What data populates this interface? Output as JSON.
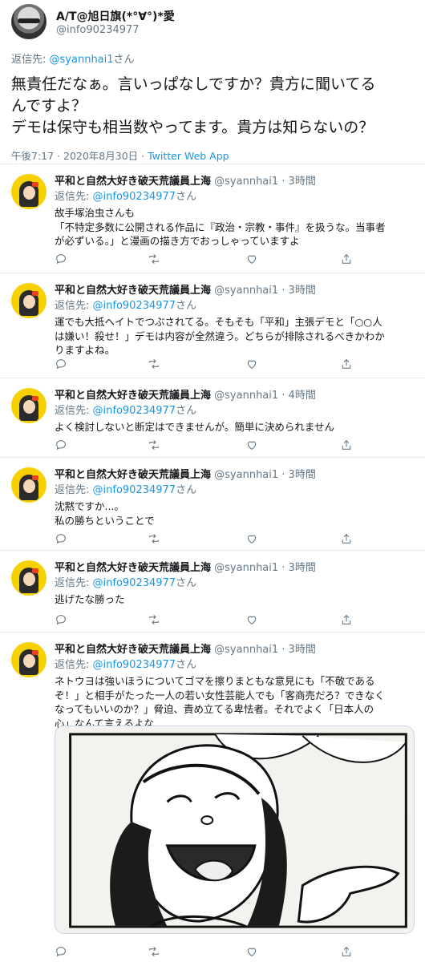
{
  "main_tweet": {
    "display_name": "A/T@旭日旗(*°∀°)*愛",
    "handle": "@info90234977",
    "reply_label": "返信先:",
    "reply_to": "@syannhai1",
    "reply_suffix": "さん",
    "text_lines": [
      "無責任だなぁ。言いっぱなしですか？貴方に聞いてる",
      "んですよ？",
      "デモは保守も相当数やってます。貴方は知らないの？"
    ],
    "time": "午後7:17 · 2020年8月30日 ·",
    "source": "Twitter Web App"
  },
  "replies": [
    {
      "display_name": "平和と自然大好き破天荒議員上海",
      "handle": "@syannhai1",
      "time": "· 3時間",
      "reply_label": "返信先:",
      "reply_to": "@info90234977",
      "reply_suffix": "さん",
      "text_lines": [
        "故手塚治虫さんも",
        "「不特定多数に公開される作品に『政治・宗教・事件』を扱うな。当事者",
        "が必ずいる。」と漫画の描き方でおっしゃっていますよ"
      ]
    },
    {
      "display_name": "平和と自然大好き破天荒議員上海",
      "handle": "@syannhai1",
      "time": "· 3時間",
      "reply_label": "返信先:",
      "reply_to": "@info90234977",
      "reply_suffix": "さん",
      "text_lines": [
        "運でも大抵ヘイトでつぶされてる。そもそも「平和」主張デモと「○○人",
        "は嫌い！殺せ！」デモは内容が全然違う。どちらが排除されるべきかわか",
        "りますよね。"
      ]
    },
    {
      "display_name": "平和と自然大好き破天荒議員上海",
      "handle": "@syannhai1",
      "time": "· 4時間",
      "reply_label": "返信先:",
      "reply_to": "@info90234977",
      "reply_suffix": "さん",
      "text_lines": [
        "よく検討しないと断定はできませんが。簡単に決められません"
      ]
    },
    {
      "display_name": "平和と自然大好き破天荒議員上海",
      "handle": "@syannhai1",
      "time": "· 3時間",
      "reply_label": "返信先:",
      "reply_to": "@info90234977",
      "reply_suffix": "さん",
      "text_lines": [
        "沈黙ですか...。",
        "私の勝ちということで"
      ]
    },
    {
      "display_name": "平和と自然大好き破天荒議員上海",
      "handle": "@syannhai1",
      "time": "· 3時間",
      "reply_label": "返信先:",
      "reply_to": "@info90234977",
      "reply_suffix": "さん",
      "text_lines": [
        "逃げたな勝った"
      ]
    },
    {
      "display_name": "平和と自然大好き破天荒議員上海",
      "handle": "@syannhai1",
      "time": "· 3時間",
      "reply_label": "返信先:",
      "reply_to": "@info90234977",
      "reply_suffix": "さん",
      "text_lines": [
        "ネトウヨは強いほうについてゴマを擦りまともな意見にも「不敬である",
        "ぞ！」と相手がたった一人の若い女性芸能人でも「客商売だろ？できなく",
        "なってもいいのか？」脅迫、責め立てる卑怯者。それでよく「日本人の",
        "心」なんて言えるよな"
      ]
    }
  ],
  "icons": [
    "reply-icon",
    "retweet-icon",
    "like-icon",
    "share-icon"
  ],
  "colors": {
    "link": "#1b95e0",
    "secondary": "#657786",
    "divider": "#e6ecf0"
  }
}
